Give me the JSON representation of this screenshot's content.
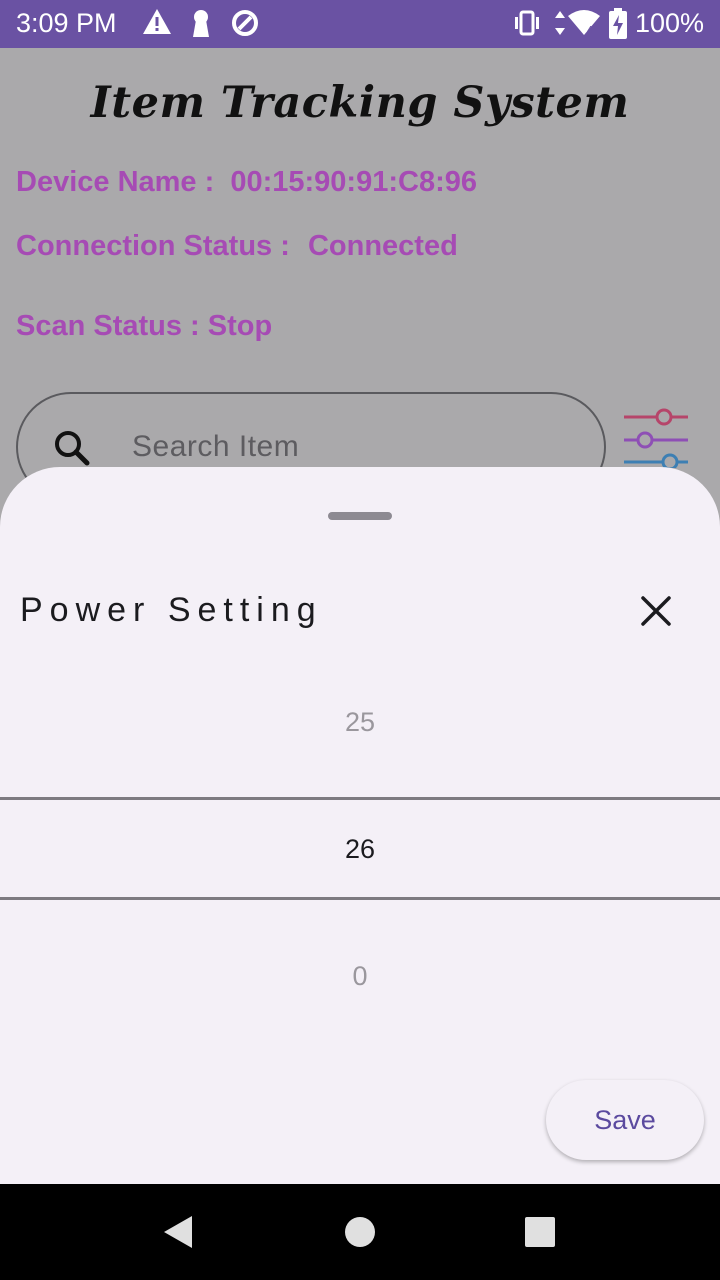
{
  "status_bar": {
    "time": "3:09 PM",
    "battery": "100%",
    "icons": [
      "warning-icon",
      "keyhole-icon",
      "data-saver-icon",
      "vibrate-icon",
      "data-arrows-icon",
      "wifi-icon",
      "battery-charging-icon"
    ]
  },
  "app": {
    "title": "Item Tracking System",
    "device_name_label": "Device Name :",
    "device_name_value": "00:15:90:91:C8:96",
    "connection_label": "Connection Status :",
    "connection_value": "Connected",
    "scan_label": "Scan Status :",
    "scan_value": "Stop",
    "search_placeholder": "Search Item",
    "colors": {
      "info_text": "#a64bb4",
      "status_bar": "#6a52a3",
      "accent": "#5b4a9f"
    }
  },
  "sheet": {
    "title": "Power Setting",
    "picker": {
      "above": "25",
      "selected": "26",
      "below": "0"
    },
    "save_label": "Save"
  },
  "nav": [
    "back-icon",
    "home-icon",
    "recents-icon"
  ]
}
